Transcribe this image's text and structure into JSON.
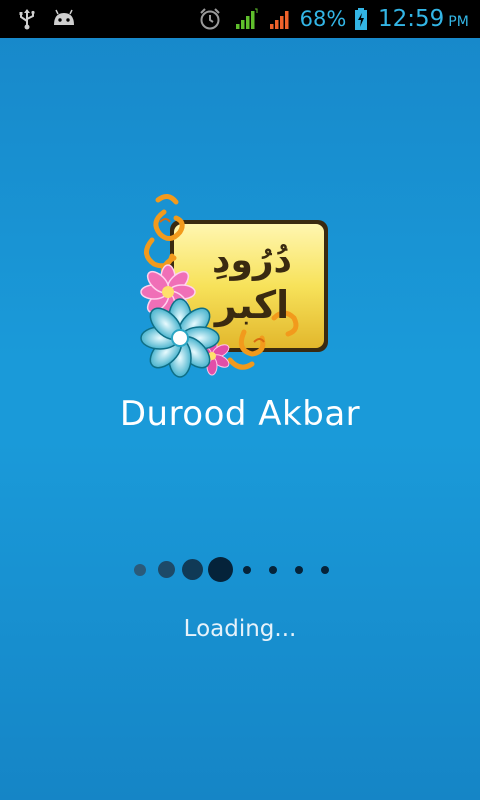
{
  "status_bar": {
    "battery_percent": "68%",
    "time": "12:59",
    "ampm": "PM",
    "icons": [
      "usb-icon",
      "android-debug-icon",
      "alarm-icon",
      "signal-icon",
      "signal-icon",
      "battery-charging-icon"
    ],
    "signal_colors": {
      "sim1": "#5fbf2c",
      "sim2": "#f0622b"
    }
  },
  "splash": {
    "logo_text": "دُرُودِ اکبر",
    "title": "Durood Akbar",
    "loading_text": "Loading..."
  },
  "colors": {
    "background": "#1a9ad9",
    "status_accent": "#33b5e5",
    "dot_dark": "#0c3450"
  }
}
